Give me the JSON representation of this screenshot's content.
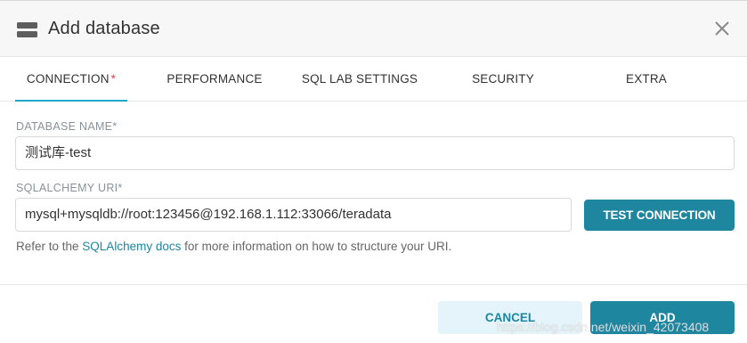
{
  "header": {
    "title": "Add database",
    "icon": "database-icon",
    "close_icon": "close-icon"
  },
  "tabs": [
    {
      "label": "CONNECTION",
      "required_mark": "*",
      "active": true
    },
    {
      "label": "PERFORMANCE"
    },
    {
      "label": "SQL LAB SETTINGS"
    },
    {
      "label": "SECURITY"
    },
    {
      "label": "EXTRA"
    }
  ],
  "form": {
    "database_name": {
      "label": "DATABASE NAME*",
      "value": "测试库-test"
    },
    "sqlalchemy_uri": {
      "label": "SQLALCHEMY URI*",
      "value": "mysql+mysqldb://root:123456@192.168.1.112:33066/teradata"
    },
    "test_connection_label": "TEST CONNECTION",
    "helper": {
      "prefix": "Refer to the ",
      "link_text": "SQLAlchemy docs",
      "suffix": " for more information on how to structure your URI."
    }
  },
  "footer": {
    "cancel_label": "CANCEL",
    "add_label": "ADD"
  },
  "watermark": "https://blog.csdn.net/weixin_42073408",
  "colors": {
    "accent": "#1f86a0",
    "tab_underline": "#20a7c9",
    "required": "#e04355",
    "cancel_bg": "#e4f4fa"
  }
}
